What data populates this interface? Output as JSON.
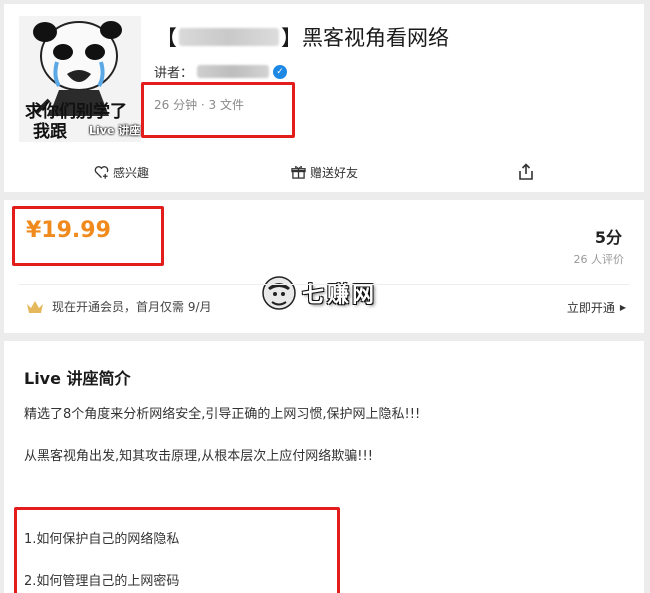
{
  "course": {
    "cover_caption_line1": "求你们别学了",
    "cover_caption_line2": "我跟",
    "cover_badge": "Live 讲座",
    "title_prefix": "【",
    "title_suffix": "】黑客视角看网络",
    "speaker_label": "讲者：",
    "meta": "26 分钟 · 3 文件"
  },
  "actions": {
    "interest": "感兴趣",
    "gift": "赠送好友"
  },
  "pricing": {
    "price": "¥19.99",
    "score": "5分",
    "reviews": "26 人评价",
    "member_text": "现在开通会员，首月仅需 9/月",
    "open_now": "立即开通"
  },
  "watermark": "七赚网",
  "intro": {
    "title": "Live 讲座简介",
    "paragraph1": "精选了8个角度来分析网络安全,引导正确的上网习惯,保护网上隐私!!!",
    "paragraph2": "从黑客视角出发,知其攻击原理,从根本层次上应付网络欺骗!!!",
    "list": [
      "1.如何保护自己的网络隐私",
      "2.如何管理自己的上网密码"
    ]
  },
  "colors": {
    "price": "#f08a1d",
    "highlight_box": "#e31c1c",
    "verified": "#1e88e5",
    "crown": "#e6b85c"
  },
  "icons": [
    "heart-plus-icon",
    "gift-icon",
    "share-icon",
    "crown-icon",
    "verified-icon",
    "play-triangle-icon"
  ]
}
